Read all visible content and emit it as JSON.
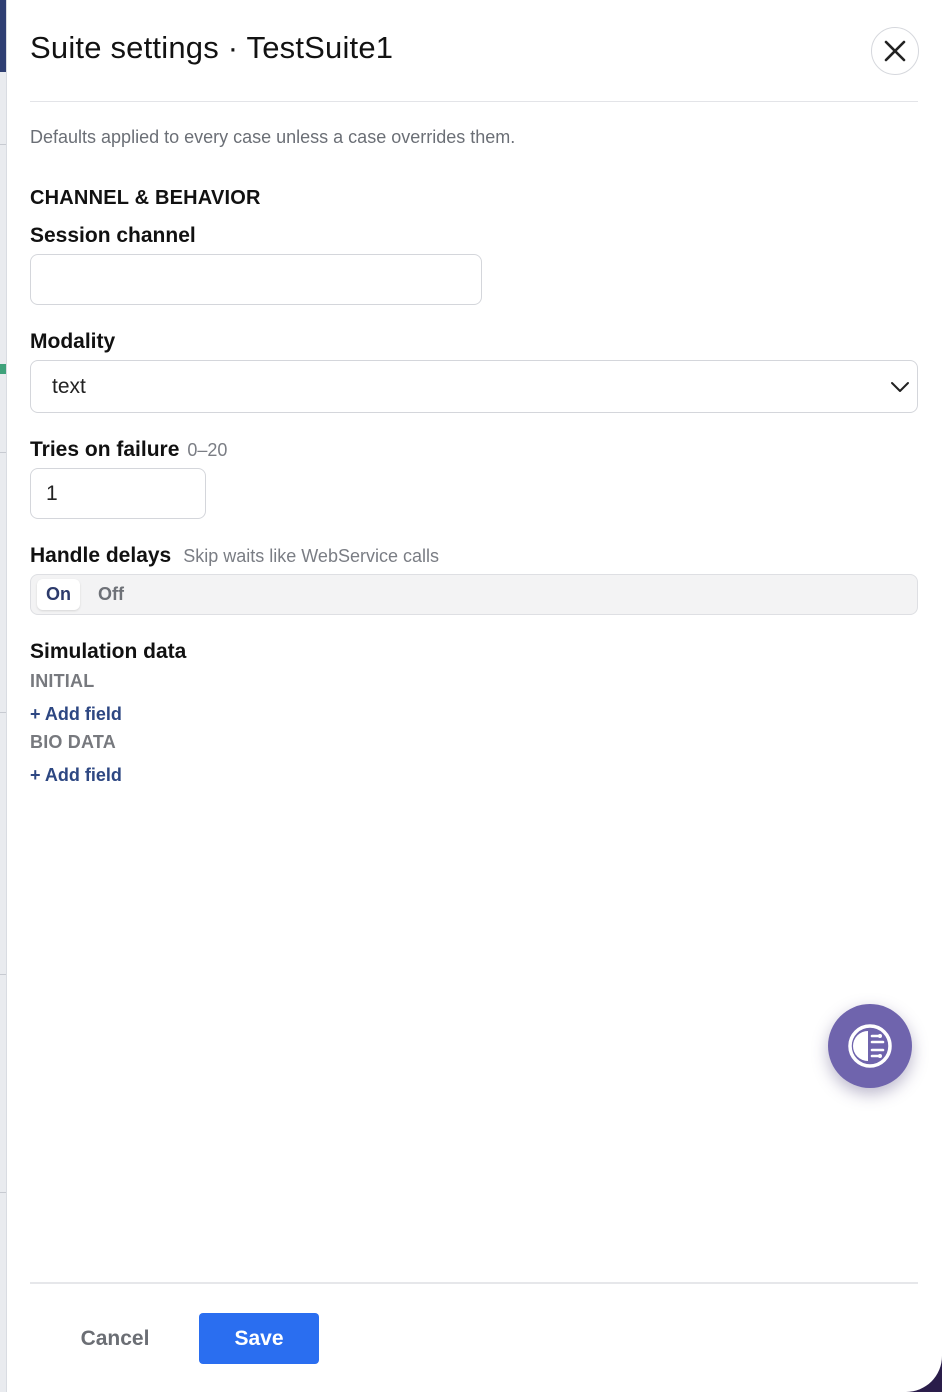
{
  "dialog": {
    "title": "Suite settings · TestSuite1",
    "subtitle": "Defaults applied to every case unless a case overrides them.",
    "close_icon": "close-icon"
  },
  "section": {
    "title": "CHANNEL & BEHAVIOR"
  },
  "session_channel": {
    "label": "Session channel",
    "value": "",
    "placeholder": ""
  },
  "modality": {
    "label": "Modality",
    "value": "text",
    "icon": "chevron-down-icon"
  },
  "tries": {
    "label": "Tries on failure",
    "hint": "0–20",
    "value": "1"
  },
  "handle_delays": {
    "label": "Handle delays",
    "hint": "Skip waits like WebService calls",
    "on_label": "On",
    "off_label": "Off",
    "selected": "On"
  },
  "simulation": {
    "label": "Simulation data",
    "groups": [
      {
        "name": "INITIAL",
        "add_label": "+ Add field"
      },
      {
        "name": "BIO DATA",
        "add_label": "+ Add field"
      }
    ]
  },
  "assistant": {
    "icon": "assistant-brain-icon"
  },
  "footer": {
    "cancel_label": "Cancel",
    "save_label": "Save"
  },
  "colors": {
    "primary": "#2a6ef0",
    "link": "#2d4782",
    "fab": "#6f64ad",
    "toggle_on_text": "#2c3a6b"
  }
}
